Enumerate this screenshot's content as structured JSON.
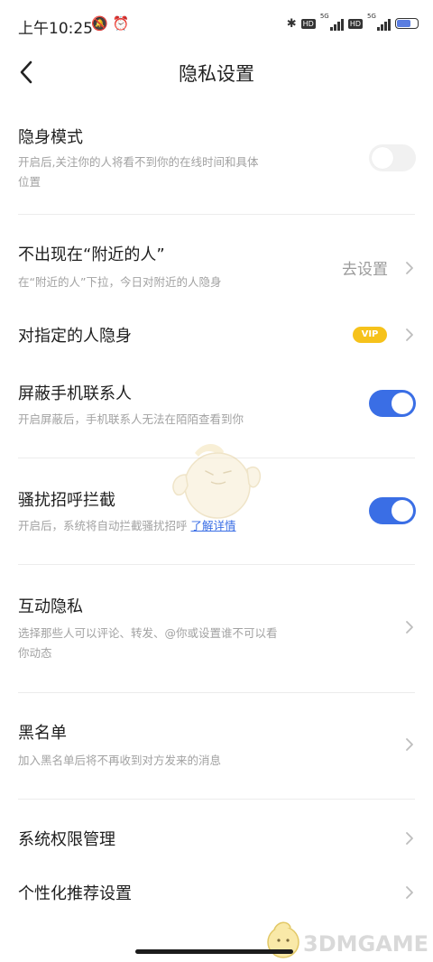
{
  "status_bar": {
    "time": "上午10:25",
    "left_icons": "🔕⏰",
    "bluetooth": "✱",
    "hd1": "HD",
    "sig1": "5G",
    "hd2": "HD",
    "sig2": "5G",
    "battery_level": 0.7,
    "battery_color": "#5a7de0"
  },
  "header": {
    "title": "隐私设置"
  },
  "rows": {
    "invisible_mode": {
      "title": "隐身模式",
      "desc_line1": "开启后,关注你的人将看不到你的在线时间和具体",
      "desc_line2": "位置",
      "toggle": "off"
    },
    "nearby": {
      "title": "不出现在“附近的人”",
      "desc": "在“附近的人”下拉，今日对附近的人隐身",
      "value": "去设置"
    },
    "hide_from_specific": {
      "title": "对指定的人隐身",
      "badge": "VIP"
    },
    "block_contacts": {
      "title": "屏蔽手机联系人",
      "desc": "开启屏蔽后，手机联系人无法在陌陌查看到你",
      "toggle": "on"
    },
    "harassment": {
      "title": "骚扰招呼拦截",
      "desc": "开启后，系统将自动拦截骚扰招呼",
      "link": "了解详情",
      "toggle": "on"
    },
    "interaction": {
      "title": "互动隐私",
      "desc_line1": "选择那些人可以评论、转发、@你或设置谁不可以看",
      "desc_line2": "你动态"
    },
    "blacklist": {
      "title": "黑名单",
      "desc": "加入黑名单后将不再收到对方发来的消息"
    },
    "permissions": {
      "title": "系统权限管理"
    },
    "personalization": {
      "title": "个性化推荐设置"
    }
  },
  "watermark": {
    "text": "3DMGAME"
  },
  "colors": {
    "accent": "#3a6ee5",
    "vip": "#f6c21b"
  }
}
